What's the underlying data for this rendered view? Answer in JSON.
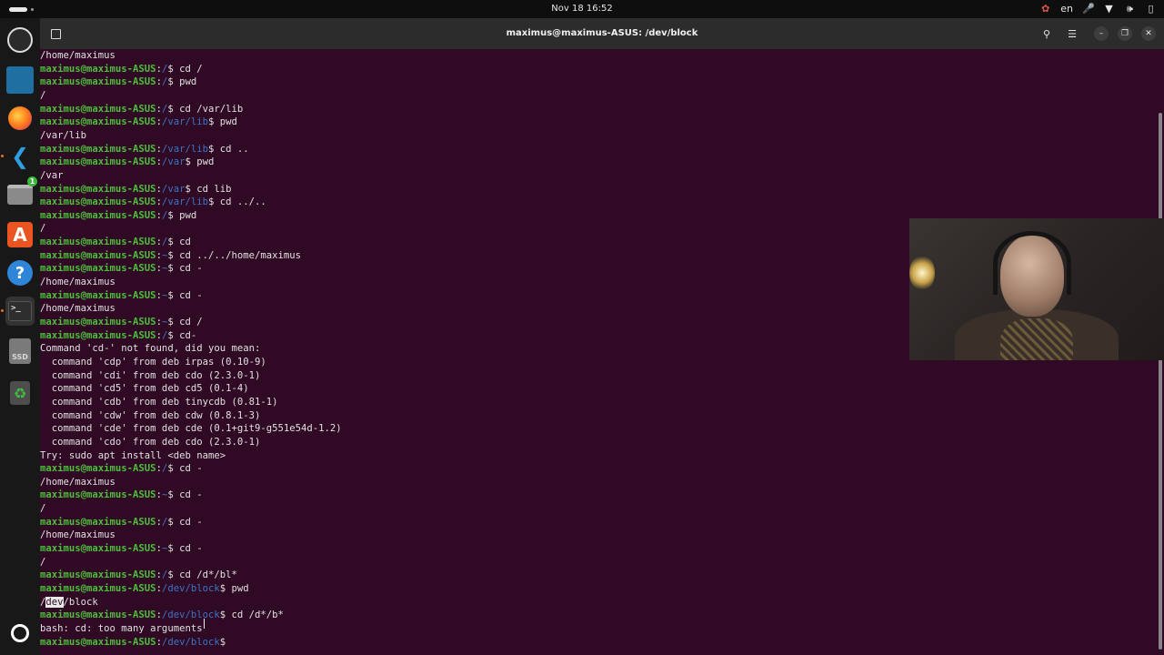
{
  "topbar": {
    "datetime": "Nov 18  16:52",
    "input_lang": "en",
    "tray_icons": [
      "ubuntu-pro-icon",
      "microphone-icon",
      "wifi-icon",
      "volume-icon",
      "battery-icon"
    ]
  },
  "dock": {
    "items": [
      {
        "name": "obs-studio",
        "icon": "obs-icon"
      },
      {
        "name": "app-panel",
        "icon": "app-icon"
      },
      {
        "name": "firefox",
        "icon": "firefox-icon"
      },
      {
        "name": "vscode",
        "icon": "vscode-icon"
      },
      {
        "name": "files",
        "icon": "files-icon",
        "badge": "1"
      },
      {
        "name": "app-center",
        "icon": "app-center-icon"
      },
      {
        "name": "help",
        "icon": "help-icon"
      },
      {
        "name": "terminal",
        "icon": "terminal-icon"
      },
      {
        "name": "ssd",
        "icon": "ssd-icon",
        "label": "SSD"
      },
      {
        "name": "trash",
        "icon": "trash-icon"
      },
      {
        "name": "show-apps",
        "icon": "ubuntu-icon"
      }
    ]
  },
  "window": {
    "title": "maximus@maximus-ASUS: /dev/block"
  },
  "terminal": {
    "user": "maximus@maximus-ASUS",
    "lines": [
      {
        "t": "out",
        "text": "/home/maximus"
      },
      {
        "t": "cmd",
        "path": "/",
        "cmd": "cd /"
      },
      {
        "t": "cmd",
        "path": "/",
        "cmd": "pwd"
      },
      {
        "t": "out",
        "text": "/"
      },
      {
        "t": "cmd",
        "path": "/",
        "cmd": "cd /var/lib"
      },
      {
        "t": "cmd",
        "path": "/var/lib",
        "cmd": "pwd"
      },
      {
        "t": "out",
        "text": "/var/lib"
      },
      {
        "t": "cmd",
        "path": "/var/lib",
        "cmd": "cd .."
      },
      {
        "t": "cmd",
        "path": "/var",
        "cmd": "pwd"
      },
      {
        "t": "out",
        "text": "/var"
      },
      {
        "t": "cmd",
        "path": "/var",
        "cmd": "cd lib"
      },
      {
        "t": "cmd",
        "path": "/var/lib",
        "cmd": "cd ../.."
      },
      {
        "t": "cmd",
        "path": "/",
        "cmd": "pwd"
      },
      {
        "t": "out",
        "text": "/"
      },
      {
        "t": "cmd",
        "path": "/",
        "cmd": "cd"
      },
      {
        "t": "cmd",
        "path": "~",
        "cmd": "cd ../../home/maximus"
      },
      {
        "t": "cmd",
        "path": "~",
        "cmd": "cd -"
      },
      {
        "t": "out",
        "text": "/home/maximus"
      },
      {
        "t": "cmd",
        "path": "~",
        "cmd": "cd -"
      },
      {
        "t": "out",
        "text": "/home/maximus"
      },
      {
        "t": "cmd",
        "path": "~",
        "cmd": "cd /"
      },
      {
        "t": "cmd",
        "path": "/",
        "cmd": "cd-"
      },
      {
        "t": "out",
        "text": "Command 'cd-' not found, did you mean:"
      },
      {
        "t": "out",
        "text": "  command 'cdp' from deb irpas (0.10-9)"
      },
      {
        "t": "out",
        "text": "  command 'cdi' from deb cdo (2.3.0-1)"
      },
      {
        "t": "out",
        "text": "  command 'cd5' from deb cd5 (0.1-4)"
      },
      {
        "t": "out",
        "text": "  command 'cdb' from deb tinycdb (0.81-1)"
      },
      {
        "t": "out",
        "text": "  command 'cdw' from deb cdw (0.8.1-3)"
      },
      {
        "t": "out",
        "text": "  command 'cde' from deb cde (0.1+git9-g551e54d-1.2)"
      },
      {
        "t": "out",
        "text": "  command 'cdo' from deb cdo (2.3.0-1)"
      },
      {
        "t": "out",
        "text": "Try: sudo apt install <deb name>"
      },
      {
        "t": "cmd",
        "path": "/",
        "cmd": "cd -"
      },
      {
        "t": "out",
        "text": "/home/maximus"
      },
      {
        "t": "cmd",
        "path": "~",
        "cmd": "cd -"
      },
      {
        "t": "out",
        "text": "/"
      },
      {
        "t": "cmd",
        "path": "/",
        "cmd": "cd -"
      },
      {
        "t": "out",
        "text": "/home/maximus"
      },
      {
        "t": "cmd",
        "path": "~",
        "cmd": "cd -"
      },
      {
        "t": "out",
        "text": "/"
      },
      {
        "t": "cmd",
        "path": "/",
        "cmd": "cd /d*/bl*"
      },
      {
        "t": "cmd",
        "path": "/dev/block",
        "cmd": "pwd"
      },
      {
        "t": "sel",
        "pre": "/",
        "sel": "dev",
        "post": "/block"
      },
      {
        "t": "cmd",
        "path": "/dev/block",
        "cmd": "cd /d*/b*"
      },
      {
        "t": "out",
        "text": "bash: cd: too many arguments"
      },
      {
        "t": "cmd",
        "path": "/dev/block",
        "cmd": ""
      }
    ]
  },
  "colors": {
    "terminal_bg": "#300a24",
    "prompt_user": "#4dbf3c",
    "prompt_path": "#3b74c7",
    "text": "#e0e0e0"
  }
}
